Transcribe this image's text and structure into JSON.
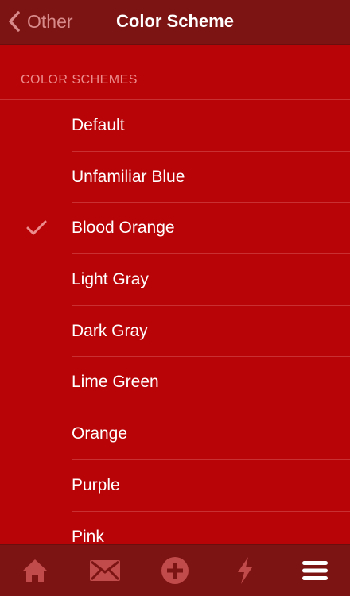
{
  "navbar": {
    "back_label": "Other",
    "title": "Color Scheme"
  },
  "section": {
    "header": "COLOR SCHEMES"
  },
  "schemes": [
    {
      "label": "Default",
      "selected": false
    },
    {
      "label": "Unfamiliar Blue",
      "selected": false
    },
    {
      "label": "Blood Orange",
      "selected": true
    },
    {
      "label": "Light Gray",
      "selected": false
    },
    {
      "label": "Dark Gray",
      "selected": false
    },
    {
      "label": "Lime Green",
      "selected": false
    },
    {
      "label": "Orange",
      "selected": false
    },
    {
      "label": "Purple",
      "selected": false
    },
    {
      "label": "Pink",
      "selected": false
    }
  ],
  "tabbar": {
    "tabs": [
      {
        "icon": "home-icon",
        "active": false
      },
      {
        "icon": "mail-icon",
        "active": false
      },
      {
        "icon": "plus-circle-icon",
        "active": false
      },
      {
        "icon": "lightning-icon",
        "active": false
      },
      {
        "icon": "menu-icon",
        "active": true
      }
    ]
  },
  "colors": {
    "background": "#b80406",
    "navbar": "#7c1414",
    "accent": "#ec8c8c",
    "inactive_icon": "#c14a4a",
    "active_icon": "#ffffff"
  }
}
